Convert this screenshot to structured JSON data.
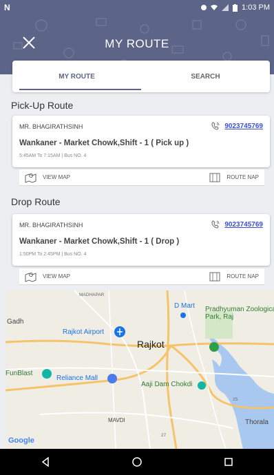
{
  "status_bar": {
    "logo": "N",
    "time": "1:03 PM"
  },
  "header": {
    "title": "MY ROUTE"
  },
  "tabs": [
    {
      "label": "MY ROUTE",
      "active": true
    },
    {
      "label": "SEARCH",
      "active": false
    }
  ],
  "pickup": {
    "section_title": "Pick-Up Route",
    "driver": "MR. BHAGIRATHSINH",
    "phone": "9023745769",
    "route": "Wankaner - Market Chowk,Shift - 1 ( Pick up )",
    "meta": "5:45AM To 7:15AM | Bus NO. 4",
    "view_map_label": "VIEW MAP",
    "route_map_label": "ROUTE NAP"
  },
  "drop": {
    "section_title": "Drop Route",
    "driver": "MR. BHAGIRATHSINH",
    "phone": "9023745769",
    "route": "Wankaner - Market Chowk,Shift - 1 ( Drop )",
    "meta": "1:50PM To 2:45PM | Bus NO. 4",
    "view_map_label": "VIEW MAP",
    "route_map_label": "ROUTE NAP"
  },
  "map": {
    "city": "Rajkot",
    "labels": {
      "madhapar": "MADHAPAR",
      "dmart": "D Mart",
      "zoo": "Pradhyuman Zoological Park, Raj",
      "gadh": "Gadh",
      "airport": "Rajkot Airport",
      "funblast": "FunBlast",
      "reliance": "Reliance Mall",
      "aaji": "Aaji Dam Chokdi",
      "mavdi": "MAVDI",
      "thorala": "Thorala",
      "road_25": "25",
      "road_27": "27"
    },
    "attribution": "Google"
  },
  "colors": {
    "brand": "#5c6487",
    "link": "#3a4fd6"
  }
}
